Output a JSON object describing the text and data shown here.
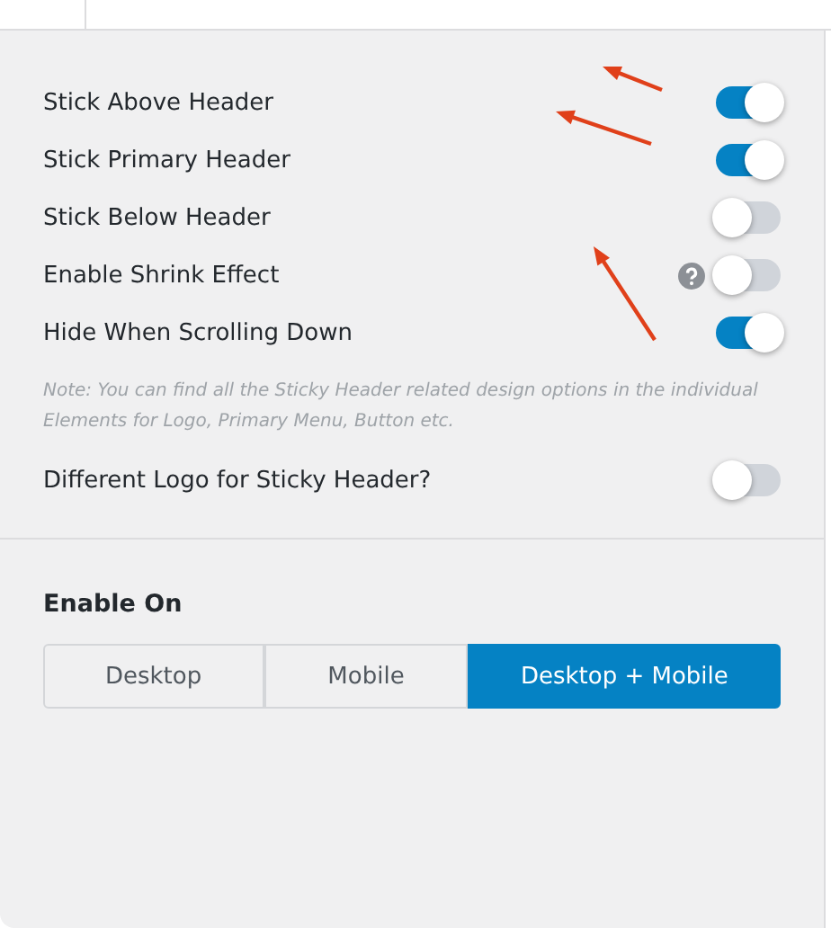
{
  "settings": [
    {
      "label": "Stick Above Header",
      "on": true,
      "help": false
    },
    {
      "label": "Stick Primary Header",
      "on": true,
      "help": false
    },
    {
      "label": "Stick Below Header",
      "on": false,
      "help": false
    },
    {
      "label": "Enable Shrink Effect",
      "on": false,
      "help": true
    },
    {
      "label": "Hide When Scrolling Down",
      "on": true,
      "help": false
    }
  ],
  "note": "Note: You can find all the Sticky Header related design options in the individual Elements for Logo, Primary Menu, Button etc.",
  "logo_setting": {
    "label": "Different Logo for Sticky Header?",
    "on": false,
    "help": false
  },
  "enable_on": {
    "title": "Enable On",
    "options": [
      {
        "label": "Desktop",
        "selected": false
      },
      {
        "label": "Mobile",
        "selected": false
      },
      {
        "label": "Desktop + Mobile",
        "selected": true
      }
    ]
  }
}
